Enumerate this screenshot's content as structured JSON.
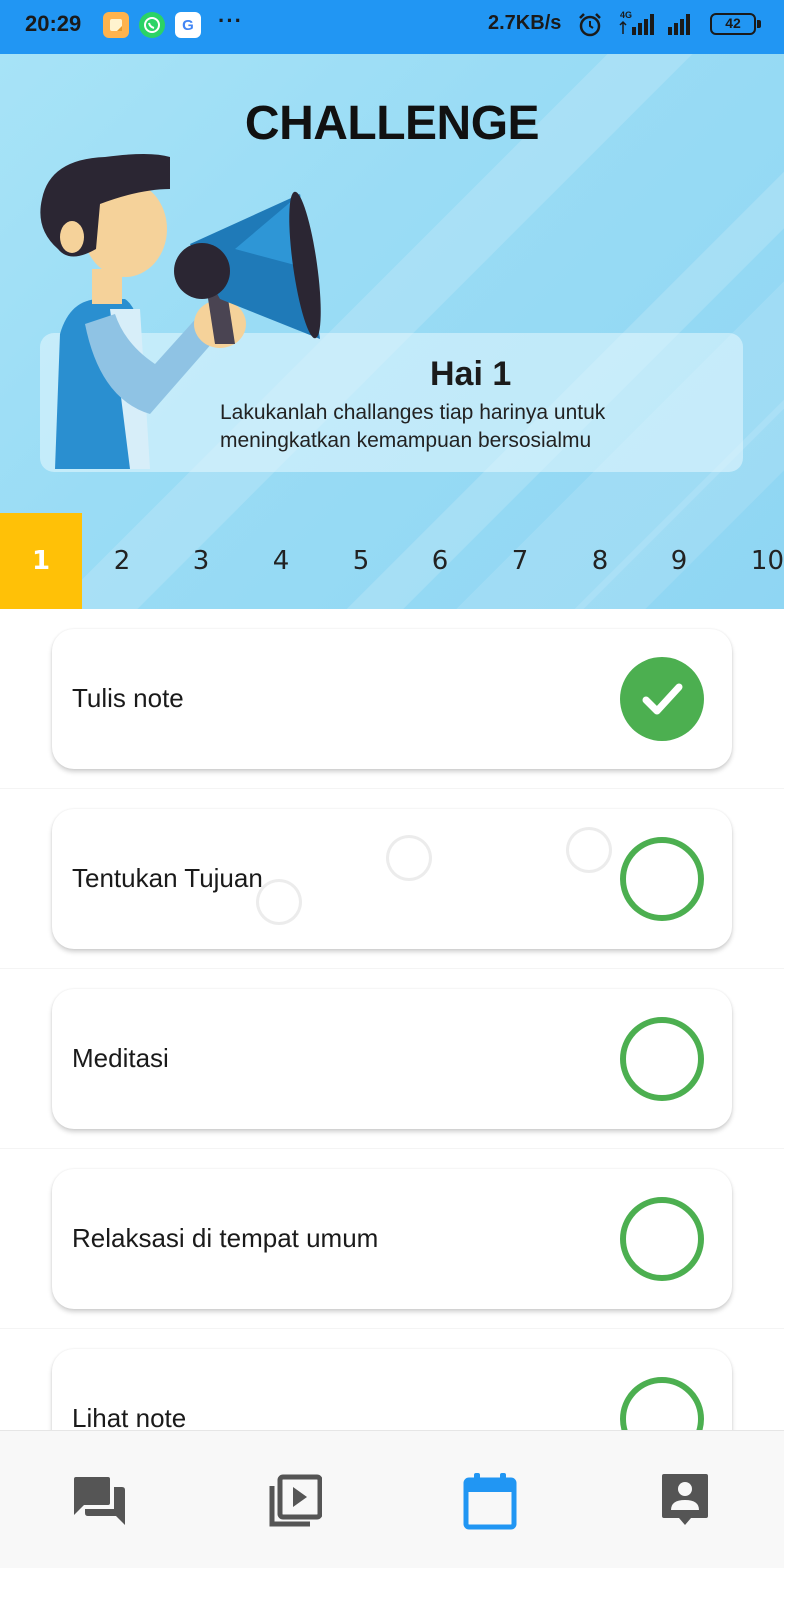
{
  "status_bar": {
    "time": "20:29",
    "more": "···",
    "net_speed": "2.7KB/s",
    "network_type": "4G",
    "battery": "42",
    "icons": [
      "notes-app-icon",
      "whatsapp-icon",
      "google-icon",
      "alarm-icon",
      "signal-icon",
      "signal-icon",
      "battery-icon"
    ]
  },
  "header": {
    "title": "CHALLENGE",
    "greeting_title": "Hai 1",
    "greeting_desc": "Lakukanlah challanges tiap harinya untuk meningkatkan kemampuan bersosialmu"
  },
  "day_tabs": {
    "selected": "1",
    "items": [
      "1",
      "2",
      "3",
      "4",
      "5",
      "6",
      "7",
      "8",
      "9",
      "10"
    ]
  },
  "challenges": [
    {
      "label": "Tulis note",
      "done": true
    },
    {
      "label": "Tentukan Tujuan",
      "done": false
    },
    {
      "label": "Meditasi",
      "done": false
    },
    {
      "label": "Relaksasi di tempat umum",
      "done": false
    },
    {
      "label": "Lihat note",
      "done": false
    }
  ],
  "bottom_nav": {
    "items": [
      "chat-icon",
      "video-library-icon",
      "calendar-icon",
      "account-icon"
    ],
    "active": "calendar-icon"
  },
  "colors": {
    "status_bar": "#2196F3",
    "header_bg": "#9adcf5",
    "selected_tab": "#FFC107",
    "check_green": "#4CAF50",
    "nav_active": "#2196F3",
    "nav_inactive": "#555555"
  }
}
